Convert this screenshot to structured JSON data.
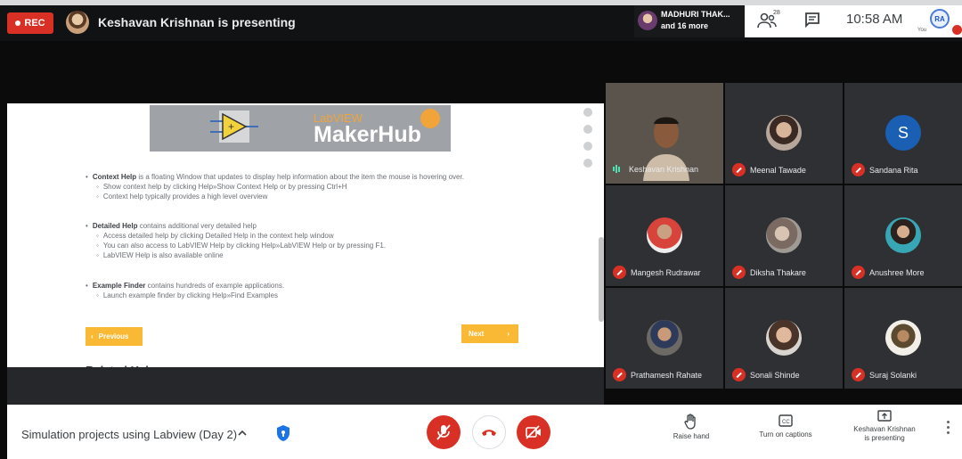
{
  "topbar": {
    "rec_label": "REC",
    "presenting_text": "Keshavan Krishnan is presenting",
    "participant_name_line1": "MADHURI THAK...",
    "participant_name_line2": "and 16 more",
    "people_count": "28",
    "time": "10:58 AM",
    "you_initials": "RA",
    "you_label": "You"
  },
  "slide": {
    "banner_small": "LabVIEW",
    "banner_big": "MakerHub",
    "sections": [
      {
        "title": "Context Help",
        "text": " is a floating Window that updates to display help information about the item the mouse is hovering over.",
        "subs": [
          "Show context help by clicking Help»Show Context Help or by pressing Ctrl+H",
          "Context help typically provides a high level overview"
        ]
      },
      {
        "title": "Detailed Help",
        "text": " contains additional very detailed help",
        "subs": [
          "Access detailed help by clicking Detailed Help in the context help window",
          "You can also access to LabVIEW Help by clicking Help»LabVIEW Help or by pressing F1.",
          "LabVIEW Help is also available online"
        ]
      },
      {
        "title": "Example Finder",
        "text": " contains hundreds of example applications.",
        "subs": [
          "Launch example finder by clicking Help»Find Examples"
        ]
      }
    ],
    "prev_label": "Previous",
    "next_label": "Next",
    "related_heading": "Related Help"
  },
  "participants": [
    {
      "name": "Keshavan Krishnan",
      "speaking": true
    },
    {
      "name": "Meenal Tawade",
      "speaking": false
    },
    {
      "name": "Sandana Rita",
      "speaking": false,
      "initial": "S"
    },
    {
      "name": "Mangesh Rudrawar",
      "speaking": false
    },
    {
      "name": "Diksha Thakare",
      "speaking": false
    },
    {
      "name": "Anushree More",
      "speaking": false
    },
    {
      "name": "Prathamesh Rahate",
      "speaking": false
    },
    {
      "name": "Sonali Shinde",
      "speaking": false
    },
    {
      "name": "Suraj Solanki",
      "speaking": false
    }
  ],
  "bottombar": {
    "meeting_title": "Simulation projects using Labview (Day 2)",
    "raise_hand": "Raise hand",
    "captions": "Turn on captions",
    "presenting_line1": "Keshavan Krishnan",
    "presenting_line2": "is presenting"
  },
  "colors": {
    "danger": "#d93025",
    "accent_yellow": "#f9b934",
    "tile_bg": "#2f3033",
    "speaking_green": "#4ce0b3"
  }
}
